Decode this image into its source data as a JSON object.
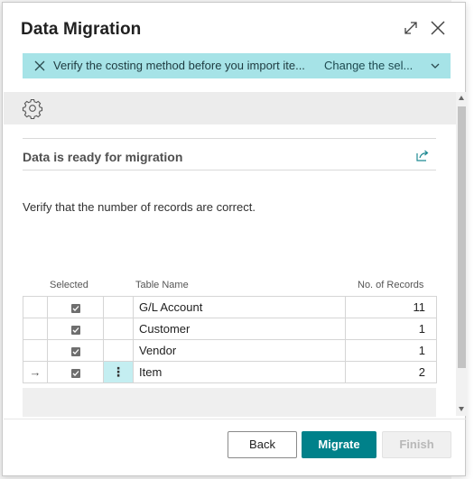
{
  "dialog": {
    "title": "Data Migration"
  },
  "notification": {
    "message": "Verify the costing method before you import ite...",
    "action_label": "Change the sel..."
  },
  "section": {
    "title": "Data is ready for migration"
  },
  "instructions": "Verify that the number of records are correct.",
  "table": {
    "headers": {
      "selected": "Selected",
      "table_name": "Table Name",
      "records": "No. of Records"
    },
    "rows": [
      {
        "selected": true,
        "name": "G/L Account",
        "records": "11"
      },
      {
        "selected": true,
        "name": "Customer",
        "records": "1"
      },
      {
        "selected": true,
        "name": "Vendor",
        "records": "1"
      },
      {
        "selected": true,
        "name": "Item",
        "records": "2",
        "current": true
      }
    ],
    "current_row_marker": "→",
    "row_action_glyph": "⋮"
  },
  "buttons": {
    "back": "Back",
    "migrate": "Migrate",
    "finish": "Finish"
  },
  "colors": {
    "accent": "#00818a",
    "notification_bg": "#a6e3e7",
    "active_cell": "#c4eef1"
  }
}
